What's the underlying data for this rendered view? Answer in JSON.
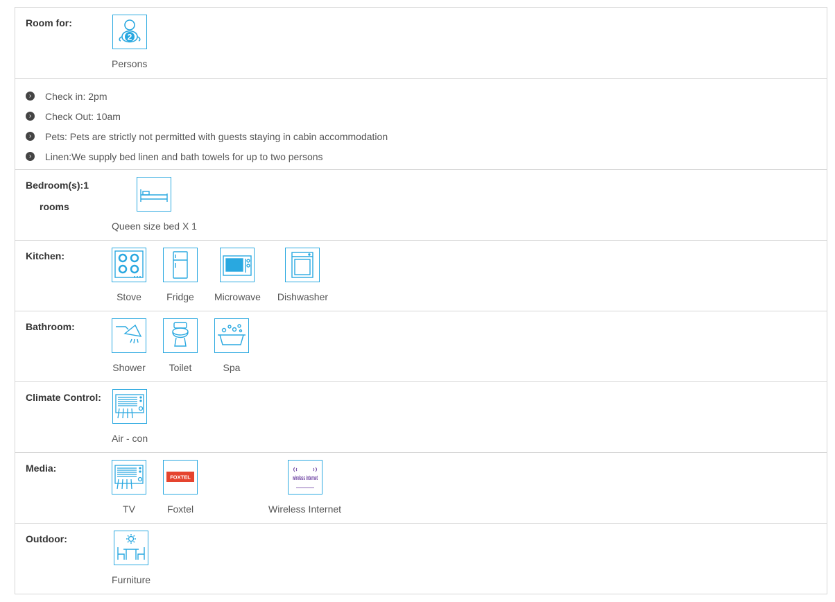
{
  "room_for": {
    "label": "Room for:",
    "persons_caption": "Persons",
    "count": "2"
  },
  "rules": [
    "Check in: 2pm",
    "Check Out: 10am",
    "Pets: Pets are strictly not permitted with guests staying in cabin accommodation",
    "Linen:We supply bed linen and bath towels for up to two persons"
  ],
  "bedrooms": {
    "label": "Bedroom(s):1",
    "label2": "rooms",
    "items": [
      {
        "caption": "Queen size bed X 1",
        "icon": "bed-icon"
      }
    ]
  },
  "kitchen": {
    "label": "Kitchen:",
    "items": [
      {
        "caption": "Stove",
        "icon": "stove-icon"
      },
      {
        "caption": "Fridge",
        "icon": "fridge-icon"
      },
      {
        "caption": "Microwave",
        "icon": "microwave-icon"
      },
      {
        "caption": "Dishwasher",
        "icon": "dishwasher-icon"
      }
    ]
  },
  "bathroom": {
    "label": "Bathroom:",
    "items": [
      {
        "caption": "Shower",
        "icon": "shower-icon"
      },
      {
        "caption": "Toilet",
        "icon": "toilet-icon"
      },
      {
        "caption": "Spa",
        "icon": "spa-icon"
      }
    ]
  },
  "climate": {
    "label": "Climate Control:",
    "items": [
      {
        "caption": "Air - con",
        "icon": "air-con-icon"
      }
    ]
  },
  "media": {
    "label": "Media:",
    "items": [
      {
        "caption": "TV",
        "icon": "tv-icon"
      },
      {
        "caption": "Foxtel",
        "icon": "foxtel-icon",
        "logo_text": "FOXTEL"
      },
      {
        "caption": "Wireless Internet",
        "icon": "wireless-internet-icon",
        "logo_text": "wireless internet"
      }
    ]
  },
  "outdoor": {
    "label": "Outdoor:",
    "items": [
      {
        "caption": "Furniture",
        "icon": "outdoor-furniture-icon"
      }
    ]
  },
  "colors": {
    "accent": "#29a8e0",
    "border": "#d6d6d6",
    "text": "#555555",
    "label": "#333333",
    "foxtel_red": "#e5442f",
    "wifi_purple": "#6b3fa0"
  }
}
